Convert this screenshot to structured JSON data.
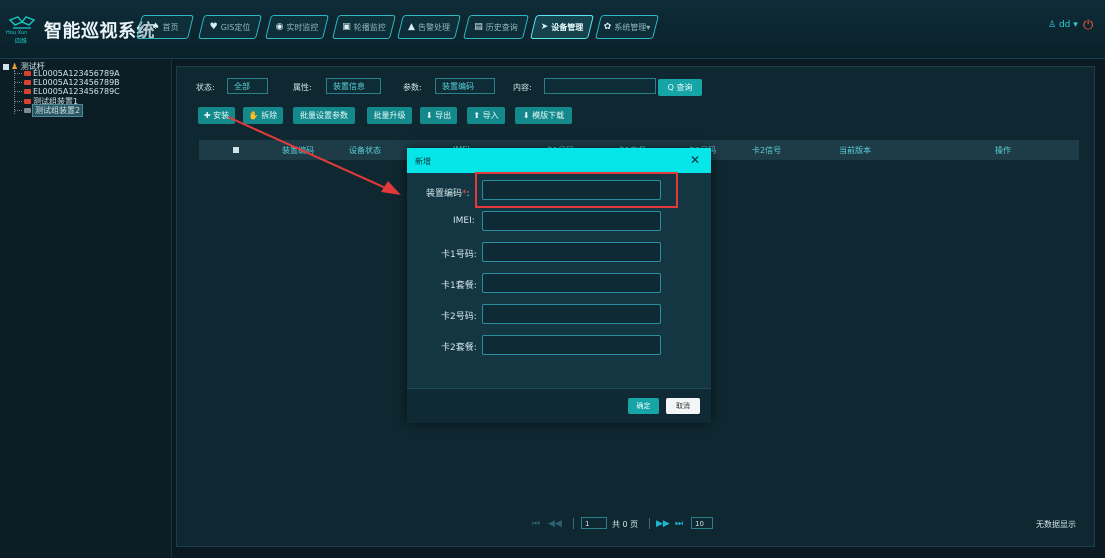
{
  "header": {
    "logo_small": "Hou Xun",
    "logo_cn": "四维",
    "title": "智能巡视系统",
    "tabs": [
      {
        "icon": "home-icon",
        "glyph": "♠",
        "label": "首页"
      },
      {
        "icon": "location-pin-icon",
        "glyph": "♥",
        "label": "GIS定位"
      },
      {
        "icon": "camera-icon",
        "glyph": "◉",
        "label": "实时监控"
      },
      {
        "icon": "wave-icon",
        "glyph": "▣",
        "label": "轮播监控"
      },
      {
        "icon": "alarm-icon",
        "glyph": "▲",
        "label": "告警处理"
      },
      {
        "icon": "history-icon",
        "glyph": "▤",
        "label": "历史查询"
      },
      {
        "icon": "device-icon",
        "glyph": "➤",
        "label": "设备管理"
      },
      {
        "icon": "settings-icon",
        "glyph": "✿",
        "label": "系统管理▾"
      }
    ],
    "user_label": "dd ▾",
    "user_glyph": "♙",
    "power_glyph": "⏻"
  },
  "sidebar": {
    "root_label": "测试杆",
    "items": [
      {
        "label": "EL0005A123456789A"
      },
      {
        "label": "EL0005A123456789B"
      },
      {
        "label": "EL0005A123456789C"
      },
      {
        "label": "测试组装置1"
      },
      {
        "label": "测试组装置2"
      }
    ]
  },
  "filters": {
    "status_label": "状态:",
    "status_value": "全部",
    "attr_label": "属性:",
    "attr_value": "装置信息",
    "param_label": "参数:",
    "param_value": "装置编码",
    "content_label": "内容:",
    "content_value": "",
    "search_label": "Q 查询"
  },
  "toolbar": {
    "install": "✚ 安装",
    "remove": "✋ 拆除",
    "batch_params": "批量设置参数",
    "batch_upgrade": "批量升级",
    "export": "⬇ 导出",
    "import": "⬆ 导入",
    "template": "⬇ 模版下载"
  },
  "table": {
    "headers": {
      "code": "装置编码",
      "state": "设备状态",
      "col3": "IMEI",
      "col4": "卡1号码",
      "col5": "卡1套餐",
      "col6": "卡2号码",
      "signal": "卡2信号",
      "version": "当前版本",
      "ops": "操作"
    }
  },
  "pager": {
    "first": "⏮",
    "prev": "◀◀",
    "page": "1",
    "total": "共 0 页",
    "next": "▶▶",
    "last": "⏭",
    "size": "10",
    "empty": "无数据显示"
  },
  "modal": {
    "title": "新增",
    "close": "✕",
    "fields": [
      {
        "label": "装置编码",
        "required": "*",
        "colon": ":"
      },
      {
        "label": "IMEI:"
      },
      {
        "label": "卡1号码:"
      },
      {
        "label": "卡1套餐:"
      },
      {
        "label": "卡2号码:"
      },
      {
        "label": "卡2套餐:"
      }
    ],
    "ok": "确定",
    "cancel": "取消"
  },
  "colors": {
    "accent": "#06e6e9",
    "button": "#13898b",
    "annotation": "#e23a3a"
  }
}
